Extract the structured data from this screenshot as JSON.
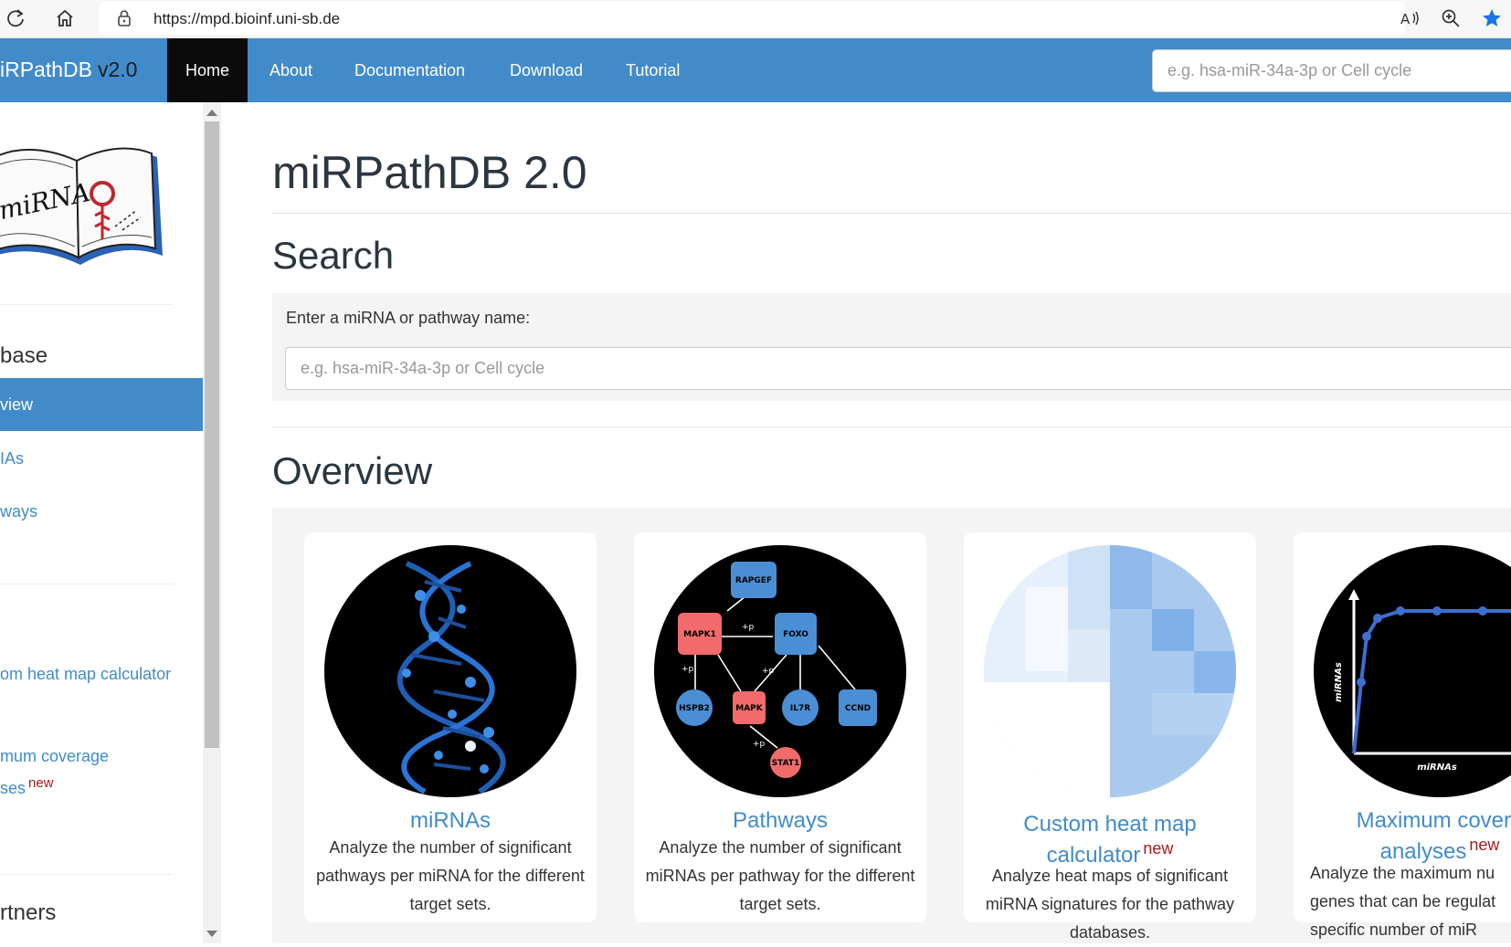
{
  "browser": {
    "url_host": "https://mpd.bioinf.uni-sb.de",
    "icons": [
      "refresh-icon",
      "home-icon",
      "lock-icon",
      "read-aloud-icon",
      "zoom-icon",
      "favorite-star-icon"
    ]
  },
  "navbar": {
    "brand": "iRPathDB",
    "brand_version": "v2.0",
    "items": [
      {
        "label": "Home",
        "active": true
      },
      {
        "label": "About"
      },
      {
        "label": "Documentation"
      },
      {
        "label": "Download"
      },
      {
        "label": "Tutorial"
      }
    ],
    "search_placeholder": "e.g. hsa-miR-34a-3p or Cell cycle"
  },
  "sidebar": {
    "logo_text": "miRNA",
    "section_database": "base",
    "links": [
      {
        "label": "view",
        "active": true
      },
      {
        "label": "IAs"
      },
      {
        "label": "ways"
      }
    ],
    "custom_heatmap": "om heat map calculator",
    "max_coverage_line1": "mum coverage",
    "max_coverage_line2": "ses",
    "new_badge": "new",
    "section_partners": "rtners"
  },
  "main": {
    "title": "miRPathDB 2.0",
    "search_heading": "Search",
    "search_label": "Enter a miRNA or pathway name:",
    "search_placeholder": "e.g. hsa-miR-34a-3p or Cell cycle",
    "overview_heading": "Overview"
  },
  "cards": [
    {
      "title": "miRNAs",
      "text": "Analyze the number of significant pathways per miRNA for the different target sets."
    },
    {
      "title": "Pathways",
      "text": "Analyze the number of significant miRNAs per pathway for the different target sets."
    },
    {
      "title_line1": "Custom heat map",
      "title_line2": "calculator",
      "badge": "new",
      "text": "Analyze heat maps of significant miRNA signatures for the pathway databases."
    },
    {
      "title_line1": "Maximum covera",
      "title_line2": "analyses",
      "badge": "new",
      "text_line1": "Analyze the maximum nu",
      "text_line2": "genes that can be regulat",
      "text_line3": "specific number of miR"
    }
  ],
  "pathway_graph": {
    "nodes": [
      "RAPGEF",
      "MAPK1",
      "FOXO",
      "HSPB2",
      "MAPK",
      "IL7R",
      "CCND",
      "STAT1"
    ],
    "edge_labels": [
      "+p",
      "+p",
      "+p",
      "+p"
    ]
  },
  "coverage_plot": {
    "ylabel": "miRNAs",
    "xlabel": "miRNAs"
  },
  "colors": {
    "primary": "#428bca",
    "nav_active": "#0b0b0b",
    "new_badge": "#a51b1b",
    "node_red": "#f26b6b",
    "node_blue": "#4a8fd6"
  }
}
